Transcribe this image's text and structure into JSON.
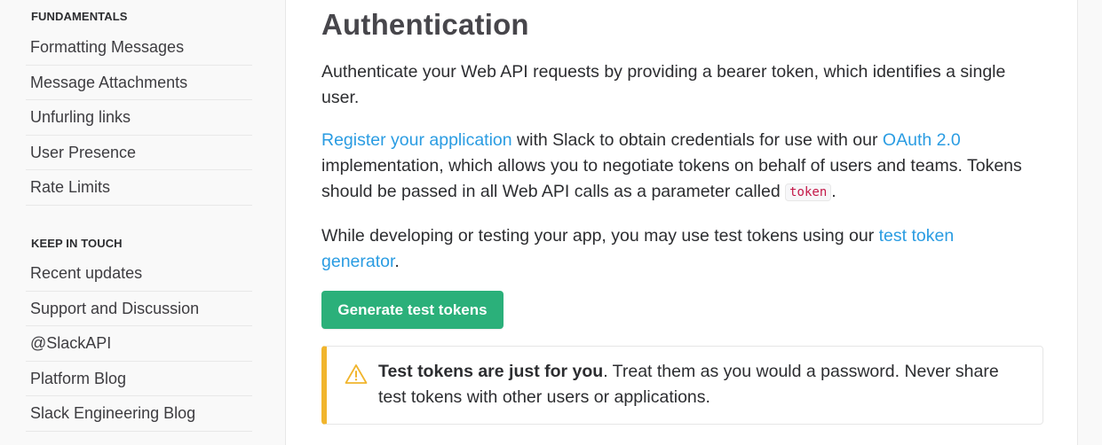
{
  "sidebar": {
    "sections": [
      {
        "heading": "FUNDAMENTALS",
        "items": [
          {
            "label": "Formatting Messages"
          },
          {
            "label": "Message Attachments"
          },
          {
            "label": "Unfurling links"
          },
          {
            "label": "User Presence"
          },
          {
            "label": "Rate Limits"
          }
        ]
      },
      {
        "heading": "KEEP IN TOUCH",
        "items": [
          {
            "label": "Recent updates"
          },
          {
            "label": "Support and Discussion"
          },
          {
            "label": "@SlackAPI"
          },
          {
            "label": "Platform Blog"
          },
          {
            "label": "Slack Engineering Blog"
          }
        ]
      }
    ]
  },
  "main": {
    "title": "Authentication",
    "intro": "Authenticate your Web API requests by providing a bearer token, which identifies a single user.",
    "register": {
      "link_register": "Register your application",
      "text_1": " with Slack to obtain credentials for use with our ",
      "link_oauth": "OAuth 2.0",
      "text_2": " implementation, which allows you to negotiate tokens on behalf of users and teams. Tokens should be passed in all Web API calls as a parameter called ",
      "code": "token",
      "text_3": "."
    },
    "testing": {
      "text_1": "While developing or testing your app, you may use test tokens using our ",
      "link": "test token generator",
      "text_2": "."
    },
    "generate_button": "Generate test tokens",
    "alert": {
      "icon": "warning-icon",
      "bold": "Test tokens are just for you",
      "text": ". Treat them as you would a password. Never share test tokens with other users or applications."
    }
  },
  "colors": {
    "link": "#2a9ce2",
    "button": "#2bb07a",
    "alert_accent": "#f1b52d",
    "code": "#c41848"
  }
}
